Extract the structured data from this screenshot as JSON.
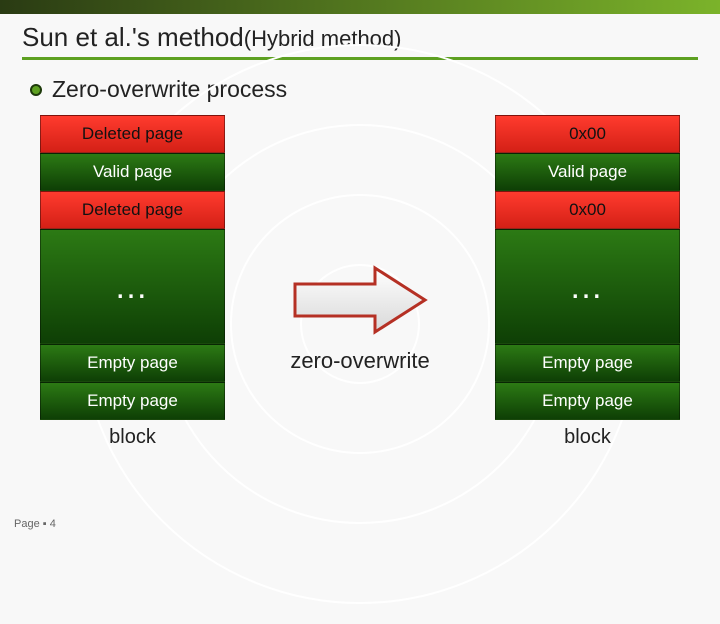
{
  "header": {
    "title_main": "Sun et al.'s method",
    "title_sub": "(Hybrid method)"
  },
  "section": {
    "heading": "Zero-overwrite process"
  },
  "left_block": {
    "pages": [
      {
        "label": "Deleted page",
        "kind": "deleted"
      },
      {
        "label": "Valid page",
        "kind": "valid"
      },
      {
        "label": "Deleted page",
        "kind": "deleted"
      },
      {
        "label": "…",
        "kind": "ellipsis"
      },
      {
        "label": "Empty page",
        "kind": "empty"
      },
      {
        "label": "Empty page",
        "kind": "empty"
      }
    ],
    "caption": "block"
  },
  "arrow": {
    "label": "zero-overwrite"
  },
  "right_block": {
    "pages": [
      {
        "label": "0x00",
        "kind": "zeroed"
      },
      {
        "label": "Valid page",
        "kind": "valid"
      },
      {
        "label": "0x00",
        "kind": "zeroed"
      },
      {
        "label": "…",
        "kind": "ellipsis"
      },
      {
        "label": "Empty page",
        "kind": "empty"
      },
      {
        "label": "Empty page",
        "kind": "empty"
      }
    ],
    "caption": "block"
  },
  "footer": {
    "page_indicator": "Page ▪ 4"
  },
  "colors": {
    "accent_green": "#5da021",
    "deleted_red": "#e4261b",
    "block_green": "#1d5a0c"
  }
}
